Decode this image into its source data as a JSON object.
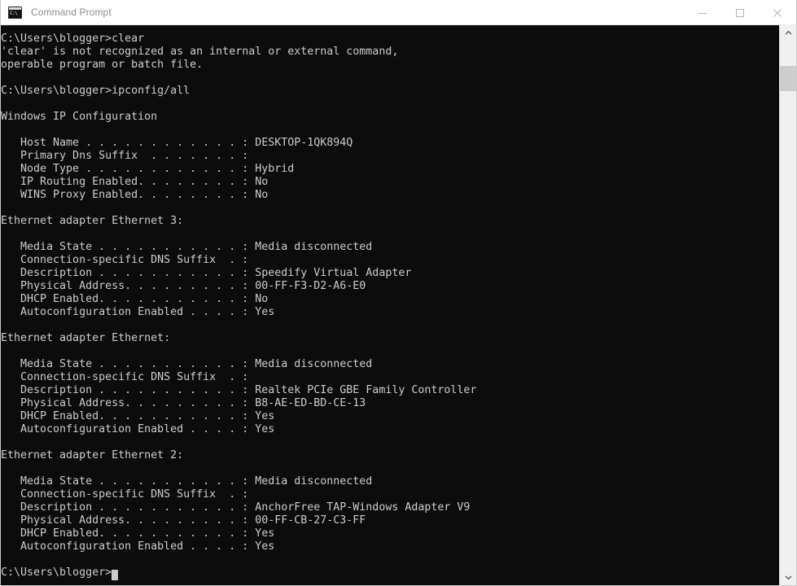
{
  "window": {
    "title": "Command Prompt",
    "icon": "cmd-icon",
    "icon_glyph": "C:\\",
    "background_color": "#0c0c0c",
    "text_color": "#cccccc",
    "titlebar_color": "#ffffff"
  },
  "window_controls": {
    "minimize": "minimize-icon",
    "maximize": "maximize-icon",
    "close": "close-icon"
  },
  "scrollbar": {
    "up_arrow": "chevron-up-icon",
    "down_arrow": "chevron-down-icon",
    "thumb": "scrollbar-thumb"
  },
  "terminal": {
    "prompt": "C:\\Users\\blogger>",
    "commands": [
      "clear",
      "ipconfig/all"
    ],
    "content": "C:\\Users\\blogger>clear\n'clear' is not recognized as an internal or external command,\noperable program or batch file.\n\nC:\\Users\\blogger>ipconfig/all\n\nWindows IP Configuration\n\n   Host Name . . . . . . . . . . . . : DESKTOP-1QK894Q\n   Primary Dns Suffix  . . . . . . . :\n   Node Type . . . . . . . . . . . . : Hybrid\n   IP Routing Enabled. . . . . . . . : No\n   WINS Proxy Enabled. . . . . . . . : No\n\nEthernet adapter Ethernet 3:\n\n   Media State . . . . . . . . . . . : Media disconnected\n   Connection-specific DNS Suffix  . :\n   Description . . . . . . . . . . . : Speedify Virtual Adapter\n   Physical Address. . . . . . . . . : 00-FF-F3-D2-A6-E0\n   DHCP Enabled. . . . . . . . . . . : No\n   Autoconfiguration Enabled . . . . : Yes\n\nEthernet adapter Ethernet:\n\n   Media State . . . . . . . . . . . : Media disconnected\n   Connection-specific DNS Suffix  . :\n   Description . . . . . . . . . . . : Realtek PCIe GBE Family Controller\n   Physical Address. . . . . . . . . : B8-AE-ED-BD-CE-13\n   DHCP Enabled. . . . . . . . . . . : Yes\n   Autoconfiguration Enabled . . . . : Yes\n\nEthernet adapter Ethernet 2:\n\n   Media State . . . . . . . . . . . : Media disconnected\n   Connection-specific DNS Suffix  . :\n   Description . . . . . . . . . . . : AnchorFree TAP-Windows Adapter V9\n   Physical Address. . . . . . . . . : 00-FF-CB-27-C3-FF\n   DHCP Enabled. . . . . . . . . . . : Yes\n   Autoconfiguration Enabled . . . . : Yes\n\n",
    "error_message": "'clear' is not recognized as an internal or external command,\noperable program or batch file.",
    "ip_configuration": {
      "heading": "Windows IP Configuration",
      "fields": [
        {
          "label": "Host Name",
          "value": "DESKTOP-1QK894Q"
        },
        {
          "label": "Primary Dns Suffix",
          "value": ""
        },
        {
          "label": "Node Type",
          "value": "Hybrid"
        },
        {
          "label": "IP Routing Enabled",
          "value": "No"
        },
        {
          "label": "WINS Proxy Enabled",
          "value": "No"
        }
      ]
    },
    "adapters": [
      {
        "heading": "Ethernet adapter Ethernet 3:",
        "fields": [
          {
            "label": "Media State",
            "value": "Media disconnected"
          },
          {
            "label": "Connection-specific DNS Suffix",
            "value": ""
          },
          {
            "label": "Description",
            "value": "Speedify Virtual Adapter"
          },
          {
            "label": "Physical Address",
            "value": "00-FF-F3-D2-A6-E0"
          },
          {
            "label": "DHCP Enabled",
            "value": "No"
          },
          {
            "label": "Autoconfiguration Enabled",
            "value": "Yes"
          }
        ]
      },
      {
        "heading": "Ethernet adapter Ethernet:",
        "fields": [
          {
            "label": "Media State",
            "value": "Media disconnected"
          },
          {
            "label": "Connection-specific DNS Suffix",
            "value": ""
          },
          {
            "label": "Description",
            "value": "Realtek PCIe GBE Family Controller"
          },
          {
            "label": "Physical Address",
            "value": "B8-AE-ED-BD-CE-13"
          },
          {
            "label": "DHCP Enabled",
            "value": "Yes"
          },
          {
            "label": "Autoconfiguration Enabled",
            "value": "Yes"
          }
        ]
      },
      {
        "heading": "Ethernet adapter Ethernet 2:",
        "fields": [
          {
            "label": "Media State",
            "value": "Media disconnected"
          },
          {
            "label": "Connection-specific DNS Suffix",
            "value": ""
          },
          {
            "label": "Description",
            "value": "AnchorFree TAP-Windows Adapter V9"
          },
          {
            "label": "Physical Address",
            "value": "00-FF-CB-27-C3-FF"
          },
          {
            "label": "DHCP Enabled",
            "value": "Yes"
          },
          {
            "label": "Autoconfiguration Enabled",
            "value": "Yes"
          }
        ]
      }
    ]
  }
}
